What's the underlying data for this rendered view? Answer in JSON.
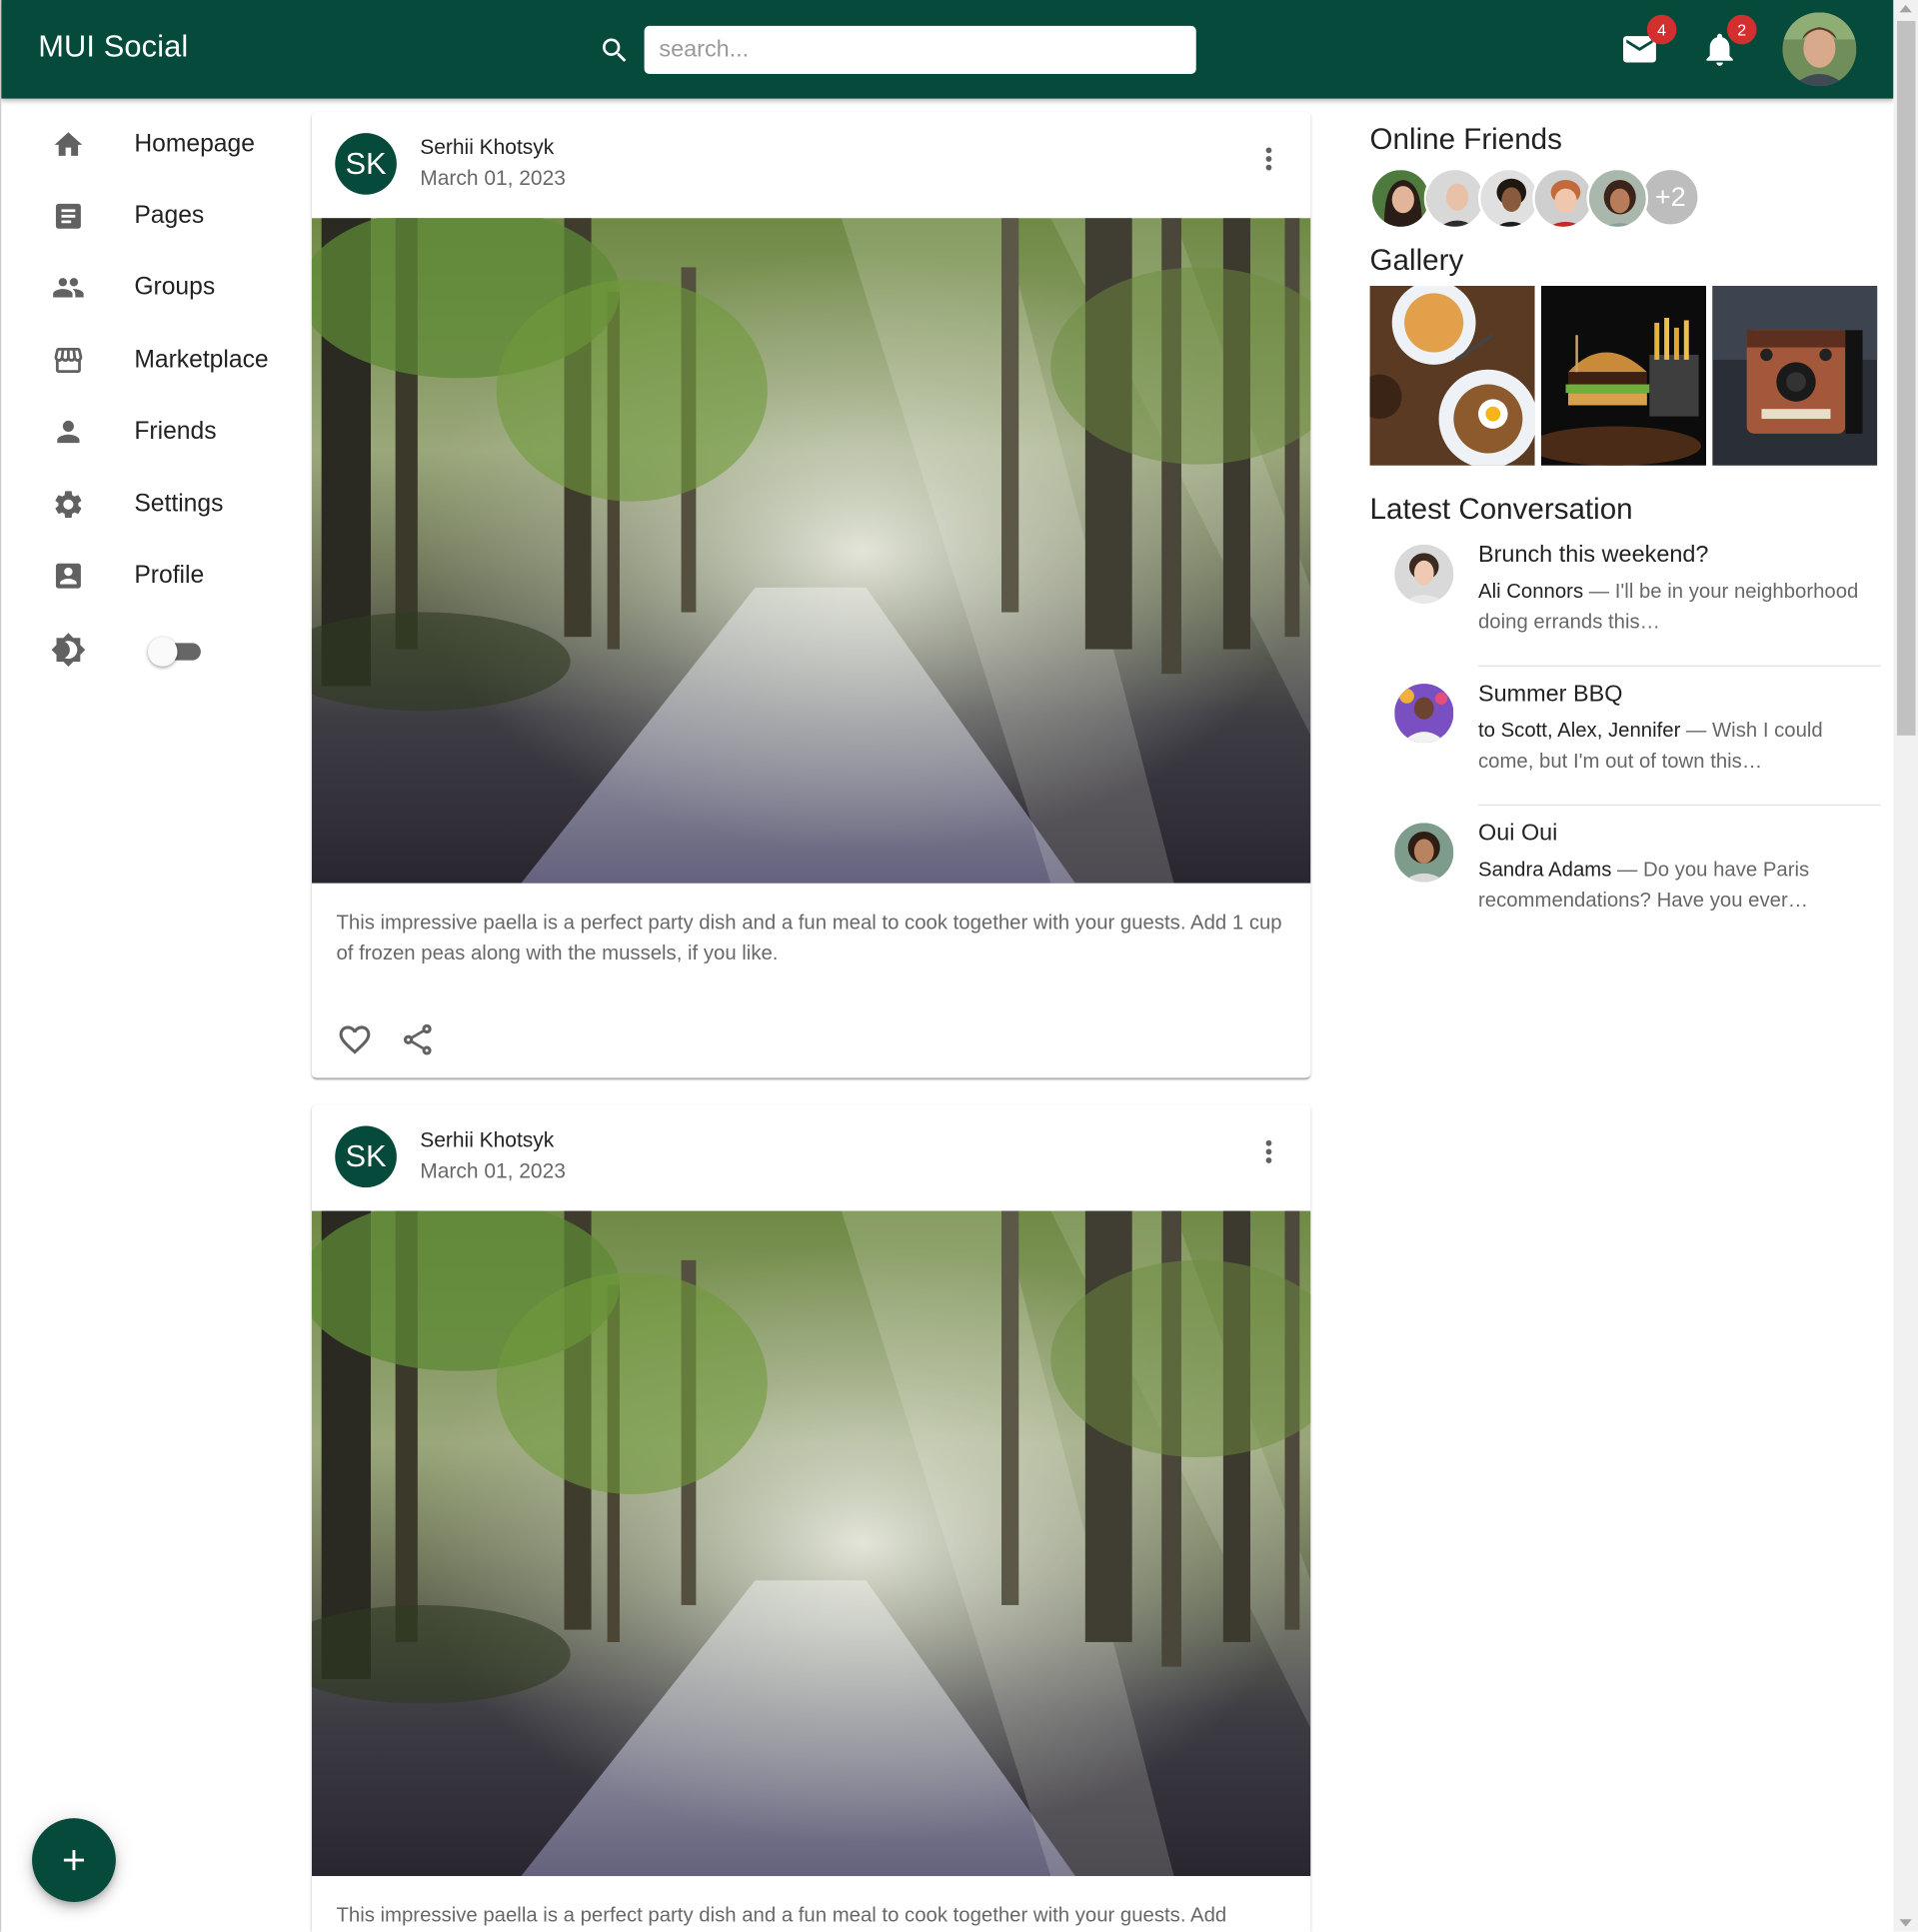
{
  "app": {
    "title": "MUI Social",
    "brand_color": "#054a3a"
  },
  "search": {
    "placeholder": "search...",
    "value": "",
    "icon": "search-icon"
  },
  "topbar": {
    "mail": {
      "icon": "mail-icon",
      "badge": "4"
    },
    "notifications": {
      "icon": "bell-icon",
      "badge": "2"
    },
    "avatar": "user-avatar"
  },
  "sidebar": {
    "items": [
      {
        "label": "Homepage",
        "icon": "home-icon"
      },
      {
        "label": "Pages",
        "icon": "article-icon"
      },
      {
        "label": "Groups",
        "icon": "group-icon"
      },
      {
        "label": "Marketplace",
        "icon": "storefront-icon"
      },
      {
        "label": "Friends",
        "icon": "person-icon"
      },
      {
        "label": "Settings",
        "icon": "gear-icon"
      },
      {
        "label": "Profile",
        "icon": "account-box-icon"
      }
    ],
    "theme_toggle": {
      "icon": "brightness-icon",
      "checked": false
    }
  },
  "posts": [
    {
      "avatar_initials": "SK",
      "author": "Serhii Khotsyk",
      "date": "March 01, 2023",
      "text": "This impressive paella is a perfect party dish and a fun meal to cook together with your guests. Add 1 cup of frozen peas along with the mussels, if you like.",
      "liked": false
    },
    {
      "avatar_initials": "SK",
      "author": "Serhii Khotsyk",
      "date": "March 01, 2023",
      "text": "This impressive paella is a perfect party dish and a fun meal to cook together with your guests. Add"
    }
  ],
  "rightbar": {
    "online_friends_title": "Online Friends",
    "online_more": "+2",
    "gallery_title": "Gallery",
    "conversation_title": "Latest Conversation",
    "conversations": [
      {
        "title": "Brunch this weekend?",
        "who": "Ali Connors",
        "snippet": " — I'll be in your neighborhood doing errands this…"
      },
      {
        "title": "Summer BBQ",
        "who": "to Scott, Alex, Jennifer",
        "snippet": " — Wish I could come, but I'm out of town this…"
      },
      {
        "title": "Oui Oui",
        "who": "Sandra Adams",
        "snippet": " — Do you have Paris recommendations? Have you ever…"
      }
    ]
  },
  "fab": {
    "icon": "add-icon"
  }
}
